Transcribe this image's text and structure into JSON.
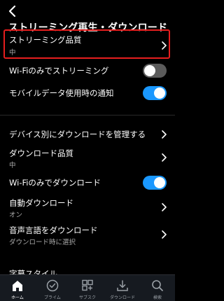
{
  "header": {
    "title": "ストリーミング再生・ダウンロード"
  },
  "settings": {
    "streaming_quality": {
      "label": "ストリーミング品質",
      "value": "中"
    },
    "wifi_only_streaming": {
      "label": "Wi-Fiのみでストリーミング",
      "enabled": false
    },
    "mobile_data_notify": {
      "label": "モバイルデータ使用時の通知",
      "enabled": true
    },
    "manage_downloads_by_device": {
      "label": "デバイス別にダウンロードを管理する"
    },
    "download_quality": {
      "label": "ダウンロード品質",
      "value": "中"
    },
    "wifi_only_download": {
      "label": "Wi-Fiのみでダウンロード",
      "enabled": true
    },
    "auto_download": {
      "label": "自動ダウンロード",
      "value": "オン"
    },
    "audio_language_download": {
      "label": "音声言語をダウンロード",
      "value": "ダウンロード時に選択"
    },
    "subtitle_style": {
      "label": "字幕スタイル"
    }
  },
  "tabs": [
    {
      "label": "ホーム",
      "icon": "home-icon",
      "active": true
    },
    {
      "label": "プライム",
      "icon": "prime-check-icon",
      "active": false
    },
    {
      "label": "サブスク",
      "icon": "subscriptions-icon",
      "active": false
    },
    {
      "label": "ダウンロード",
      "icon": "download-icon",
      "active": false
    },
    {
      "label": "検索",
      "icon": "search-icon",
      "active": false
    }
  ],
  "colors": {
    "background": "#000000",
    "accent_toggle_on": "#1a98ff",
    "toggle_off": "#5b5b5b",
    "highlight_border": "#e61e1e",
    "tabbar": "#161a20"
  }
}
